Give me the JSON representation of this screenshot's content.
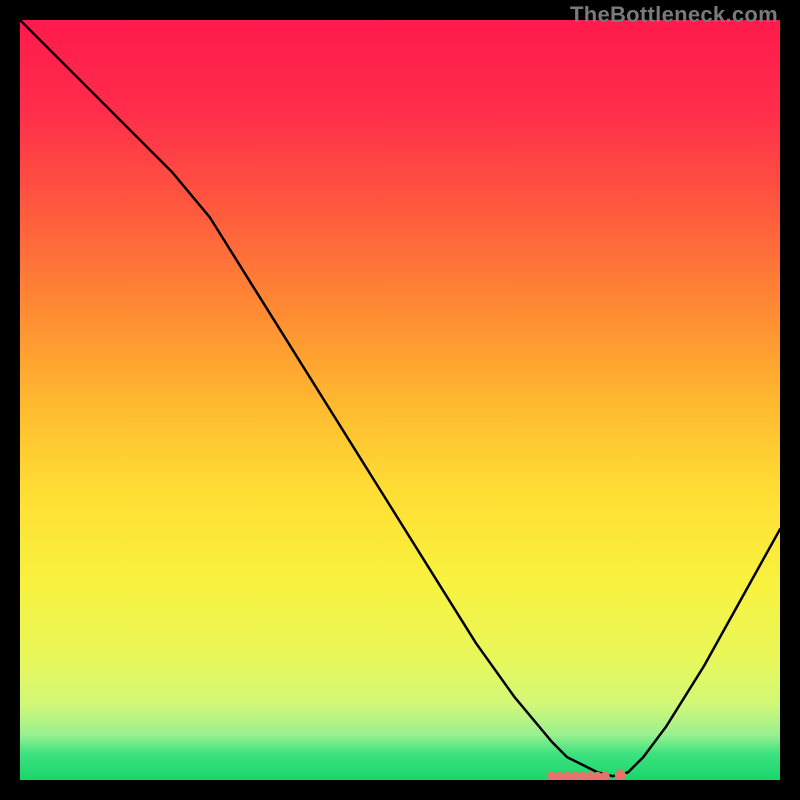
{
  "watermark": "TheBottleneck.com",
  "chart_data": {
    "type": "line",
    "title": "",
    "xlabel": "",
    "ylabel": "",
    "xlim": [
      0,
      100
    ],
    "ylim": [
      0,
      100
    ],
    "grid": false,
    "x": [
      0,
      5,
      10,
      15,
      20,
      25,
      30,
      35,
      40,
      45,
      50,
      55,
      60,
      65,
      70,
      72,
      74,
      76,
      78,
      80,
      82,
      85,
      90,
      95,
      100
    ],
    "values": [
      100,
      95,
      90,
      85,
      80,
      74,
      66,
      58,
      50,
      42,
      34,
      26,
      18,
      11,
      5,
      3,
      2,
      1,
      0.5,
      1,
      3,
      7,
      15,
      24,
      33
    ],
    "marker_points_x": [
      70,
      71,
      72,
      73,
      74,
      75,
      76,
      77,
      79
    ],
    "marker_points_y": [
      0.5,
      0.5,
      0.5,
      0.5,
      0.5,
      0.5,
      0.5,
      0.5,
      0.6
    ],
    "gradient_stops": [
      {
        "pos": 0.0,
        "color": "#ff1a4d"
      },
      {
        "pos": 0.12,
        "color": "#ff2d4a"
      },
      {
        "pos": 0.25,
        "color": "#ff5a3e"
      },
      {
        "pos": 0.38,
        "color": "#ff8a33"
      },
      {
        "pos": 0.5,
        "color": "#ffb72f"
      },
      {
        "pos": 0.62,
        "color": "#ffde34"
      },
      {
        "pos": 0.74,
        "color": "#f8f23e"
      },
      {
        "pos": 0.84,
        "color": "#e8f75a"
      },
      {
        "pos": 0.9,
        "color": "#d2f877"
      },
      {
        "pos": 0.94,
        "color": "#9af090"
      },
      {
        "pos": 0.965,
        "color": "#3fe27f"
      },
      {
        "pos": 1.0,
        "color": "#18d66b"
      }
    ],
    "curve_color": "#000000",
    "marker_color": "#e8736a"
  }
}
